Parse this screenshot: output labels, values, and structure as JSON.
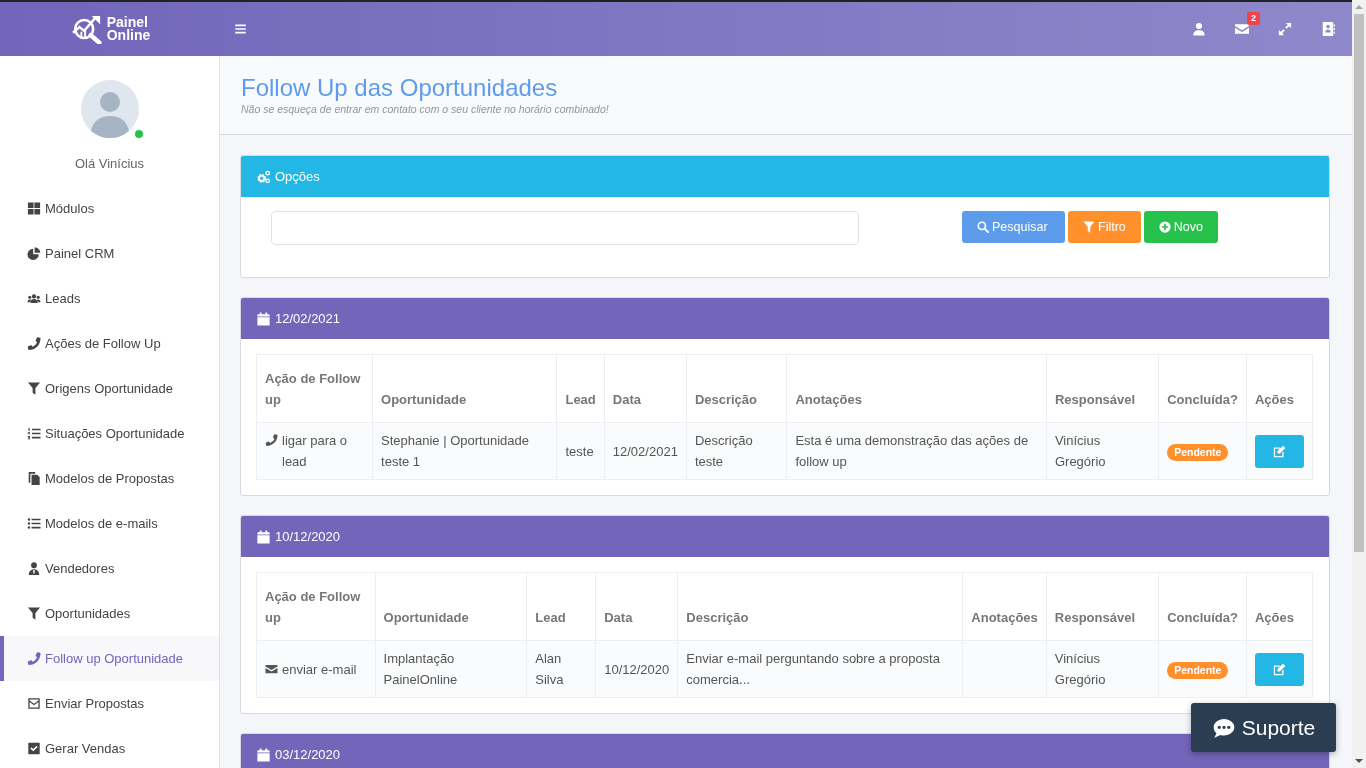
{
  "topbar": {
    "logo_text": "Painel Online",
    "mail_badge": "2"
  },
  "sidebar": {
    "greeting": "Olá Vinícius",
    "online": true,
    "items": [
      {
        "label": "Módulos",
        "selected": false
      },
      {
        "label": "Painel CRM",
        "selected": false
      },
      {
        "label": "Leads",
        "selected": false
      },
      {
        "label": "Ações de Follow Up",
        "selected": false
      },
      {
        "label": "Origens Oportunidade",
        "selected": false
      },
      {
        "label": "Situações Oportunidade",
        "selected": false
      },
      {
        "label": "Modelos de Propostas",
        "selected": false
      },
      {
        "label": "Modelos de e-mails",
        "selected": false
      },
      {
        "label": "Vendedores",
        "selected": false
      },
      {
        "label": "Oportunidades",
        "selected": false
      },
      {
        "label": "Follow up Oportunidade",
        "selected": true
      },
      {
        "label": "Enviar Propostas",
        "selected": false
      },
      {
        "label": "Gerar Vendas",
        "selected": false
      }
    ]
  },
  "page_header": {
    "title": "Follow Up das Oportunidades",
    "subtitle": "Não se esqueça de entrar em contato com o seu cliente no horário combinado!"
  },
  "options_panel": {
    "title": "Opções",
    "buttons": [
      {
        "label": "Pesquisar",
        "kind": "search"
      },
      {
        "label": "Filtro",
        "kind": "filter"
      },
      {
        "label": "Novo",
        "kind": "new"
      }
    ]
  },
  "groups": [
    {
      "date": "12/02/2021",
      "columns": [
        "Ação de Follow up",
        "Oportunidade",
        "Lead",
        "Data",
        "Descrição",
        "Anotações",
        "Responsável",
        "Concluída?",
        "Ações"
      ],
      "rows": [
        {
          "action": {
            "kind": "call",
            "text": "ligar para o lead"
          },
          "opportunity": "Stephanie | Oportunidade teste 1",
          "lead": "teste",
          "date": "12/02/2021",
          "description": "Descrição teste",
          "notes": "Esta é uma demonstração das ações de follow up",
          "responsible": "Vinícius Gregório",
          "status": {
            "label": "Pendente",
            "concluded": false
          }
        }
      ]
    },
    {
      "date": "10/12/2020",
      "columns": [
        "Ação de Follow up",
        "Oportunidade",
        "Lead",
        "Data",
        "Descrição",
        "Anotações",
        "Responsável",
        "Concluída?",
        "Ações"
      ],
      "rows": [
        {
          "action": {
            "kind": "email",
            "text": "enviar e-mail"
          },
          "opportunity": "Implantação PainelOnline",
          "lead": "Alan Silva",
          "date": "10/12/2020",
          "description": "Enviar e-mail perguntando sobre a proposta comercia...",
          "responsible": "Vinícius Gregório",
          "status": {
            "label": "Pendente",
            "concluded": false
          }
        }
      ]
    },
    {
      "date": "03/12/2020"
    }
  ],
  "support_button": {
    "label": "Suporte"
  }
}
